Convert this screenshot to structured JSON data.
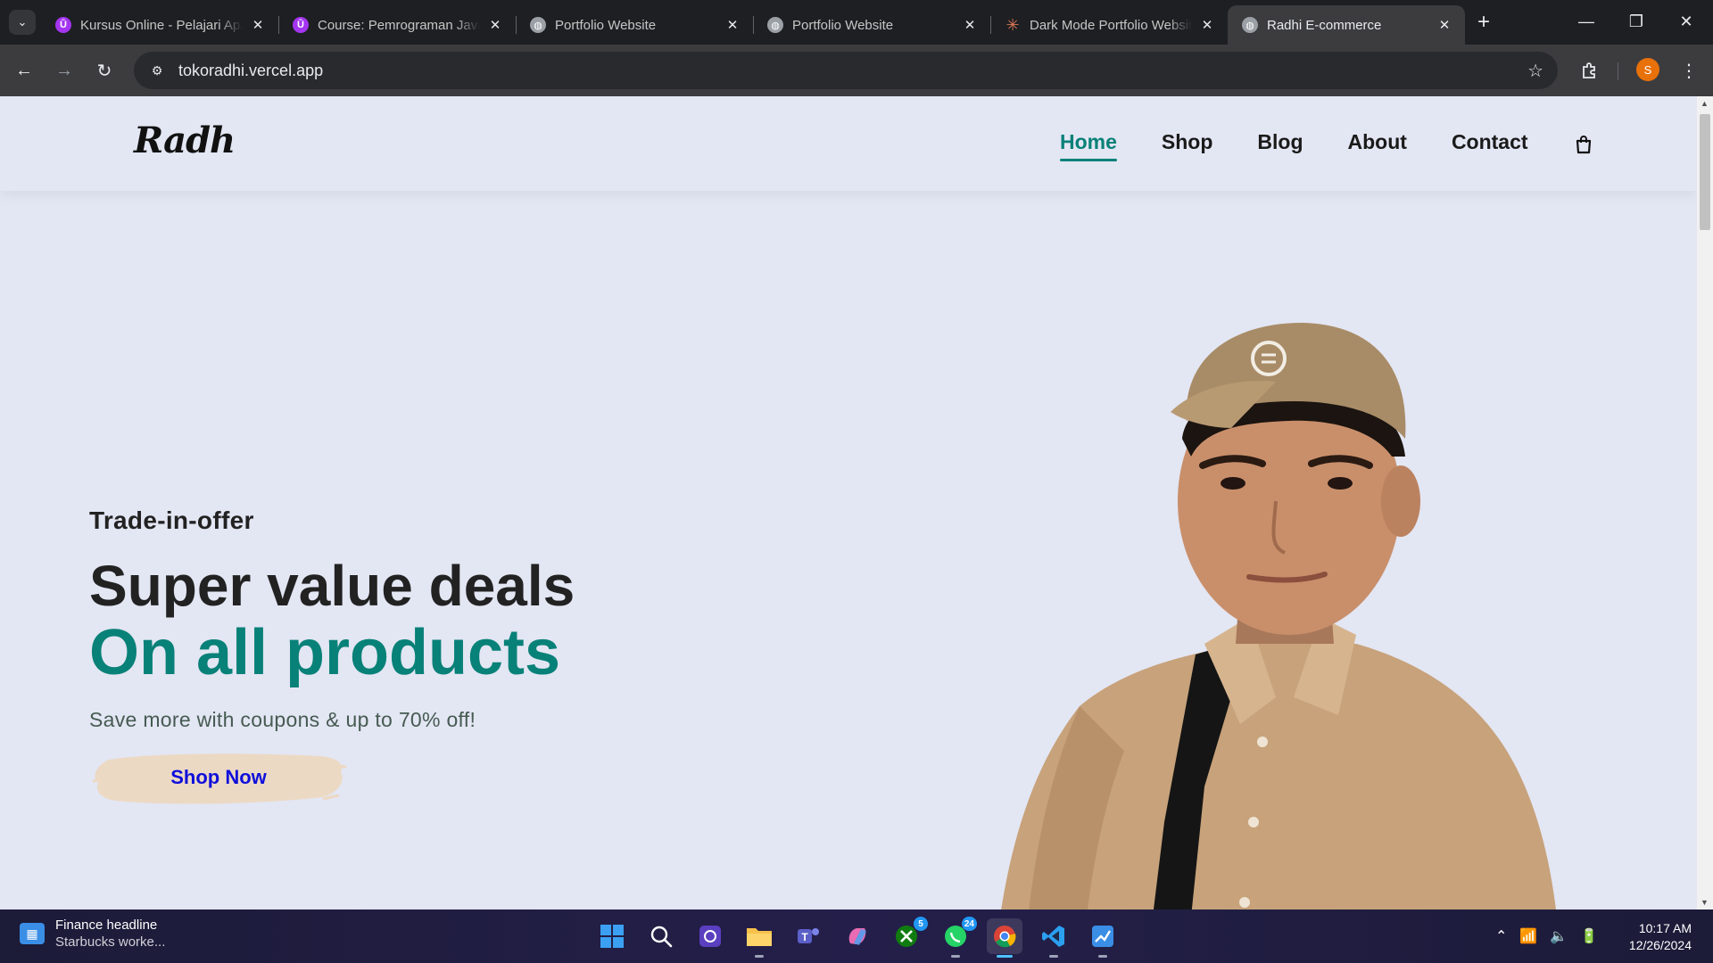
{
  "browser": {
    "tabs": [
      {
        "title": "Kursus Online - Pelajari Apa Saja",
        "favicon": "udemy-icon",
        "active": false
      },
      {
        "title": "Course: Pemrograman JavaScript",
        "favicon": "udemy-icon",
        "active": false
      },
      {
        "title": "Portfolio Website",
        "favicon": "globe-icon",
        "active": false
      },
      {
        "title": "Portfolio Website",
        "favicon": "globe-icon",
        "active": false
      },
      {
        "title": "Dark Mode Portfolio Website",
        "favicon": "claude-icon",
        "active": false
      },
      {
        "title": "Radhi E-commerce",
        "favicon": "globe-icon",
        "active": true
      }
    ],
    "url": "tokoradhi.vercel.app",
    "profile_initial": "S",
    "colors": {
      "frame": "#1e1f22",
      "toolbar": "#3c3c3f",
      "profile": "#e8710a"
    }
  },
  "site": {
    "logo": "Radh",
    "nav": [
      {
        "label": "Home",
        "active": true
      },
      {
        "label": "Shop",
        "active": false
      },
      {
        "label": "Blog",
        "active": false
      },
      {
        "label": "About",
        "active": false
      },
      {
        "label": "Contact",
        "active": false
      }
    ],
    "cart_icon": "shopping-bag-icon",
    "hero": {
      "eyebrow": "Trade-in-offer",
      "heading": "Super value deals",
      "highlight": "On all products",
      "subtext": "Save more with coupons & up to 70% off!",
      "cta": "Shop Now"
    },
    "colors": {
      "background": "#e3e6f3",
      "accent": "#088178",
      "cta_text": "#0f0fdb",
      "cta_brush": "#ecd9c3"
    }
  },
  "taskbar": {
    "news": {
      "title": "Finance headline",
      "subtitle": "Starbucks worke..."
    },
    "apps": [
      {
        "name": "start-icon",
        "badge": ""
      },
      {
        "name": "search-icon",
        "badge": ""
      },
      {
        "name": "copilot-app-icon",
        "badge": ""
      },
      {
        "name": "file-explorer-icon",
        "badge": ""
      },
      {
        "name": "teams-icon",
        "badge": ""
      },
      {
        "name": "copilot-icon",
        "badge": ""
      },
      {
        "name": "xbox-icon",
        "badge": "5"
      },
      {
        "name": "whatsapp-icon",
        "badge": "24"
      },
      {
        "name": "chrome-icon",
        "badge": ""
      },
      {
        "name": "vscode-icon",
        "badge": ""
      },
      {
        "name": "paint-icon",
        "badge": ""
      }
    ],
    "time": "10:17 AM",
    "date": "12/26/2024"
  }
}
